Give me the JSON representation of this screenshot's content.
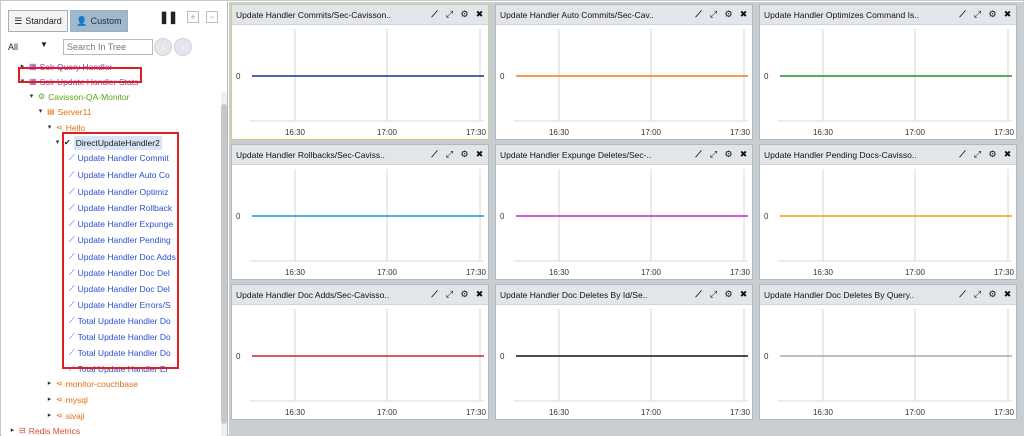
{
  "sidebar": {
    "tabs": [
      {
        "label": "Standard",
        "icon": "list-icon"
      },
      {
        "label": "Custom",
        "icon": "user-gear-icon"
      }
    ],
    "filter_value": "All",
    "search_placeholder": "Search In Tree",
    "tree": [
      {
        "label": "Solr Query Handler",
        "icon": "grid-icon",
        "color": "#8a3fb0",
        "depth": 1,
        "toggle": "▸"
      },
      {
        "label": "Solr Update Handler Stats",
        "icon": "grid-icon",
        "color": "#8a3fb0",
        "depth": 1,
        "toggle": "▾"
      },
      {
        "label": "Cavisson-QA-Monitor",
        "icon": "cogs-icon",
        "color": "#5aa51b",
        "depth": 2,
        "toggle": "▾"
      },
      {
        "label": "Server11",
        "icon": "server-icon",
        "color": "#e36f13",
        "depth": 3,
        "toggle": "▾"
      },
      {
        "label": "Hello",
        "icon": "share-icon",
        "color": "#e36f13",
        "depth": 4,
        "toggle": "▾"
      },
      {
        "label": "DirectUpdateHandler2",
        "icon": "check-icon",
        "color": "#1a1a1a",
        "depth": 5,
        "toggle": "▾",
        "highlight": true
      },
      {
        "label": "Update Handler Commit",
        "icon": "line-chart-icon",
        "color": "#2a4fd4",
        "depth": 6,
        "toggle": ""
      },
      {
        "label": "Update Handler Auto Co",
        "icon": "line-chart-icon",
        "color": "#2a4fd4",
        "depth": 6,
        "toggle": ""
      },
      {
        "label": "Update Handler Optimiz",
        "icon": "line-chart-icon",
        "color": "#2a4fd4",
        "depth": 6,
        "toggle": ""
      },
      {
        "label": "Update Handler Rollback",
        "icon": "line-chart-icon",
        "color": "#2a4fd4",
        "depth": 6,
        "toggle": ""
      },
      {
        "label": "Update Handler Expunge",
        "icon": "line-chart-icon",
        "color": "#2a4fd4",
        "depth": 6,
        "toggle": ""
      },
      {
        "label": "Update Handler Pending",
        "icon": "line-chart-icon",
        "color": "#2a4fd4",
        "depth": 6,
        "toggle": ""
      },
      {
        "label": "Update Handler Doc Adds",
        "icon": "line-chart-icon",
        "color": "#2a4fd4",
        "depth": 6,
        "toggle": ""
      },
      {
        "label": "Update Handler Doc Del",
        "icon": "line-chart-icon",
        "color": "#2a4fd4",
        "depth": 6,
        "toggle": ""
      },
      {
        "label": "Update Handler Doc Del",
        "icon": "line-chart-icon",
        "color": "#2a4fd4",
        "depth": 6,
        "toggle": ""
      },
      {
        "label": "Update Handler Errors/S",
        "icon": "line-chart-icon",
        "color": "#2a4fd4",
        "depth": 6,
        "toggle": ""
      },
      {
        "label": "Total Update Handler Do",
        "icon": "line-chart-icon",
        "color": "#2a4fd4",
        "depth": 6,
        "toggle": ""
      },
      {
        "label": "Total Update Handler Do",
        "icon": "line-chart-icon",
        "color": "#2a4fd4",
        "depth": 6,
        "toggle": ""
      },
      {
        "label": "Total Update Handler Do",
        "icon": "line-chart-icon",
        "color": "#2a4fd4",
        "depth": 6,
        "toggle": ""
      },
      {
        "label": "Total Update Handler Er",
        "icon": "line-chart-icon",
        "color": "#2a4fd4",
        "depth": 6,
        "toggle": ""
      },
      {
        "label": "monitor-couchbase",
        "icon": "share-icon",
        "color": "#e36f13",
        "depth": 4,
        "toggle": "▸"
      },
      {
        "label": "mysql",
        "icon": "share-icon",
        "color": "#e36f13",
        "depth": 4,
        "toggle": "▸"
      },
      {
        "label": "sivaji",
        "icon": "share-icon",
        "color": "#e36f13",
        "depth": 4,
        "toggle": "▸"
      },
      {
        "label": "Redis Metrics",
        "icon": "db-icon",
        "color": "#d64b3a",
        "depth": 0,
        "toggle": "▸"
      }
    ]
  },
  "dashboard": {
    "panel_actions": [
      "line-chart-icon",
      "expand-icon",
      "gear-icon",
      "close-icon"
    ],
    "x_ticks": [
      "16:30",
      "17:00",
      "17:30"
    ],
    "y_tick": "0",
    "panels": [
      {
        "title": "Update Handler Commits/Sec-Cavisson..",
        "line_color": "#1f2a8c",
        "active": true
      },
      {
        "title": "Update Handler Auto Commits/Sec-Cav..",
        "line_color": "#f07a1d"
      },
      {
        "title": "Update Handler Optimizes Command Is..",
        "line_color": "#2a8a22"
      },
      {
        "title": "Update Handler Rollbacks/Sec-Caviss..",
        "line_color": "#1e90e0"
      },
      {
        "title": "Update Handler Expunge Deletes/Sec-..",
        "line_color": "#c02ac8"
      },
      {
        "title": "Update Handler Pending Docs-Cavisso..",
        "line_color": "#f0a010"
      },
      {
        "title": "Update Handler Doc Adds/Sec-Cavisso..",
        "line_color": "#b83030"
      },
      {
        "title": "Update Handler Doc Deletes By Id/Se..",
        "line_color": "#111111"
      },
      {
        "title": "Update Handler Doc Deletes By Query..",
        "line_color": "#a8a8a8"
      }
    ]
  }
}
